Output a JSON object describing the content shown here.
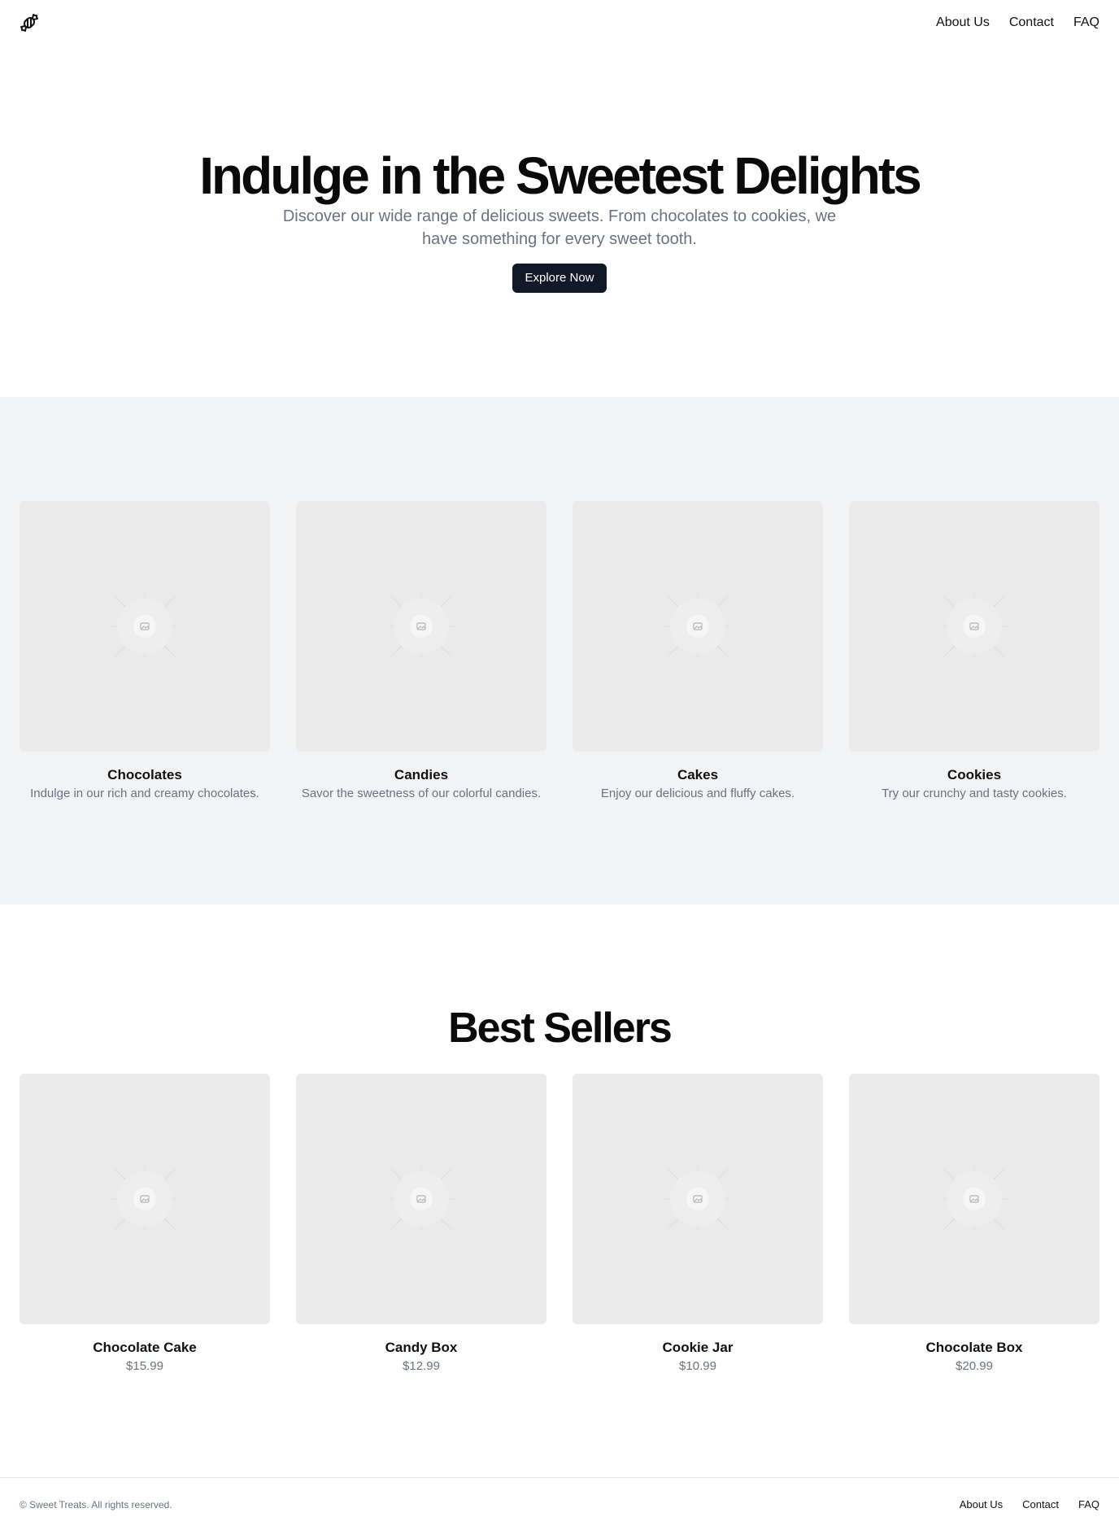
{
  "header": {
    "logo_icon": "candy-icon",
    "nav": [
      {
        "label": "About Us"
      },
      {
        "label": "Contact"
      },
      {
        "label": "FAQ"
      }
    ]
  },
  "hero": {
    "title": "Indulge in the Sweetest Delights",
    "subtitle": "Discover our wide range of delicious sweets. From chocolates to cookies, we have something for every sweet tooth.",
    "cta_label": "Explore Now",
    "cta_color": "#111827"
  },
  "categories": [
    {
      "name": "Chocolates",
      "description": "Indulge in our rich and creamy chocolates."
    },
    {
      "name": "Candies",
      "description": "Savor the sweetness of our colorful candies."
    },
    {
      "name": "Cakes",
      "description": "Enjoy our delicious and fluffy cakes."
    },
    {
      "name": "Cookies",
      "description": "Try our crunchy and tasty cookies."
    }
  ],
  "best_sellers": {
    "title": "Best Sellers",
    "items": [
      {
        "name": "Chocolate Cake",
        "price": "$15.99"
      },
      {
        "name": "Candy Box",
        "price": "$12.99"
      },
      {
        "name": "Cookie Jar",
        "price": "$10.99"
      },
      {
        "name": "Chocolate Box",
        "price": "$20.99"
      }
    ]
  },
  "footer": {
    "copyright": "© Sweet Treats. All rights reserved.",
    "nav": [
      {
        "label": "About Us"
      },
      {
        "label": "Contact"
      },
      {
        "label": "FAQ"
      }
    ]
  },
  "colors": {
    "section_bg": "#f2f3f5",
    "placeholder_bg": "#eaeaea",
    "muted_text": "#6b7280"
  }
}
